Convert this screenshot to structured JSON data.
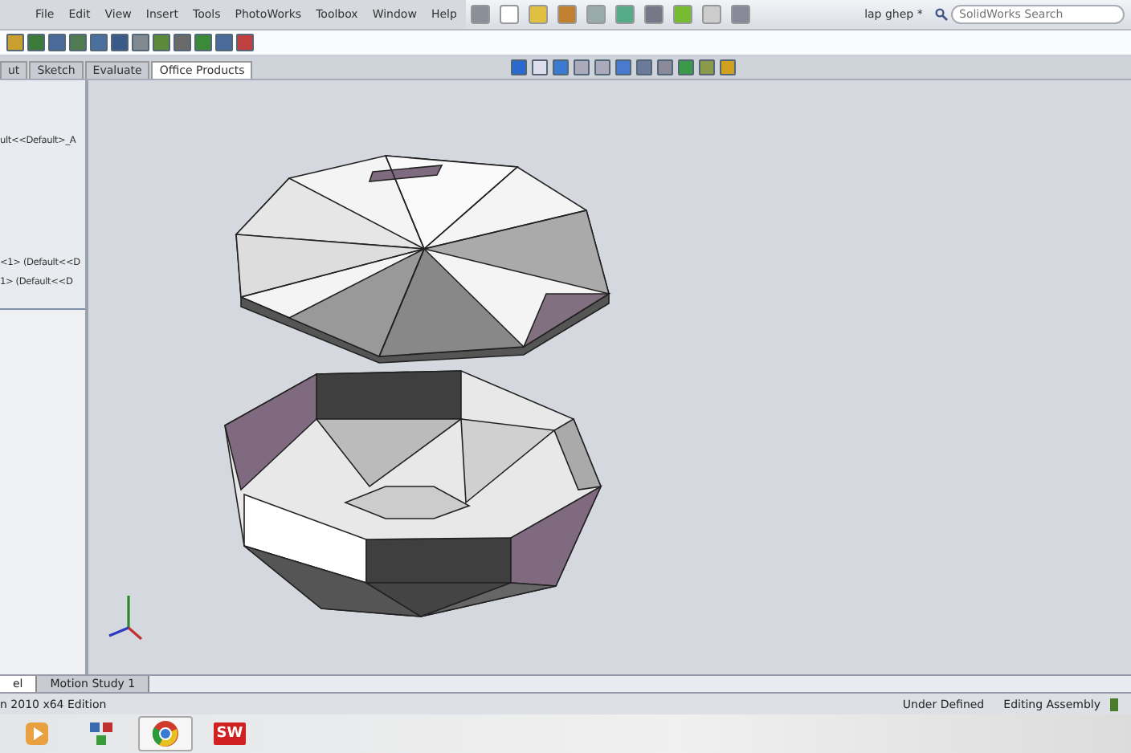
{
  "menu": [
    "File",
    "Edit",
    "View",
    "Insert",
    "Tools",
    "PhotoWorks",
    "Toolbox",
    "Window",
    "Help"
  ],
  "window": {
    "title": "lap ghep *"
  },
  "search": {
    "placeholder": "SolidWorks Search"
  },
  "command_tabs": [
    {
      "label": "ut",
      "selected": false
    },
    {
      "label": "Sketch",
      "selected": false
    },
    {
      "label": "Evaluate",
      "selected": false
    },
    {
      "label": "Office Products",
      "selected": true
    }
  ],
  "tree": {
    "items": [
      "ult<<Default>_A",
      "<1> (Default<<D",
      "1> (Default<<D"
    ]
  },
  "bottom_tabs": [
    {
      "label": "el",
      "selected": true
    },
    {
      "label": "Motion Study 1",
      "selected": false
    }
  ],
  "status_bar": {
    "edition": "n 2010 x64 Edition",
    "state": "Under Defined",
    "mode": "Editing Assembly"
  },
  "taskbar": {
    "items": [
      {
        "kind": "media"
      },
      {
        "kind": "tiles"
      },
      {
        "kind": "browser",
        "selected": true
      },
      {
        "kind": "cad",
        "label": "SW",
        "selected": false
      }
    ]
  }
}
